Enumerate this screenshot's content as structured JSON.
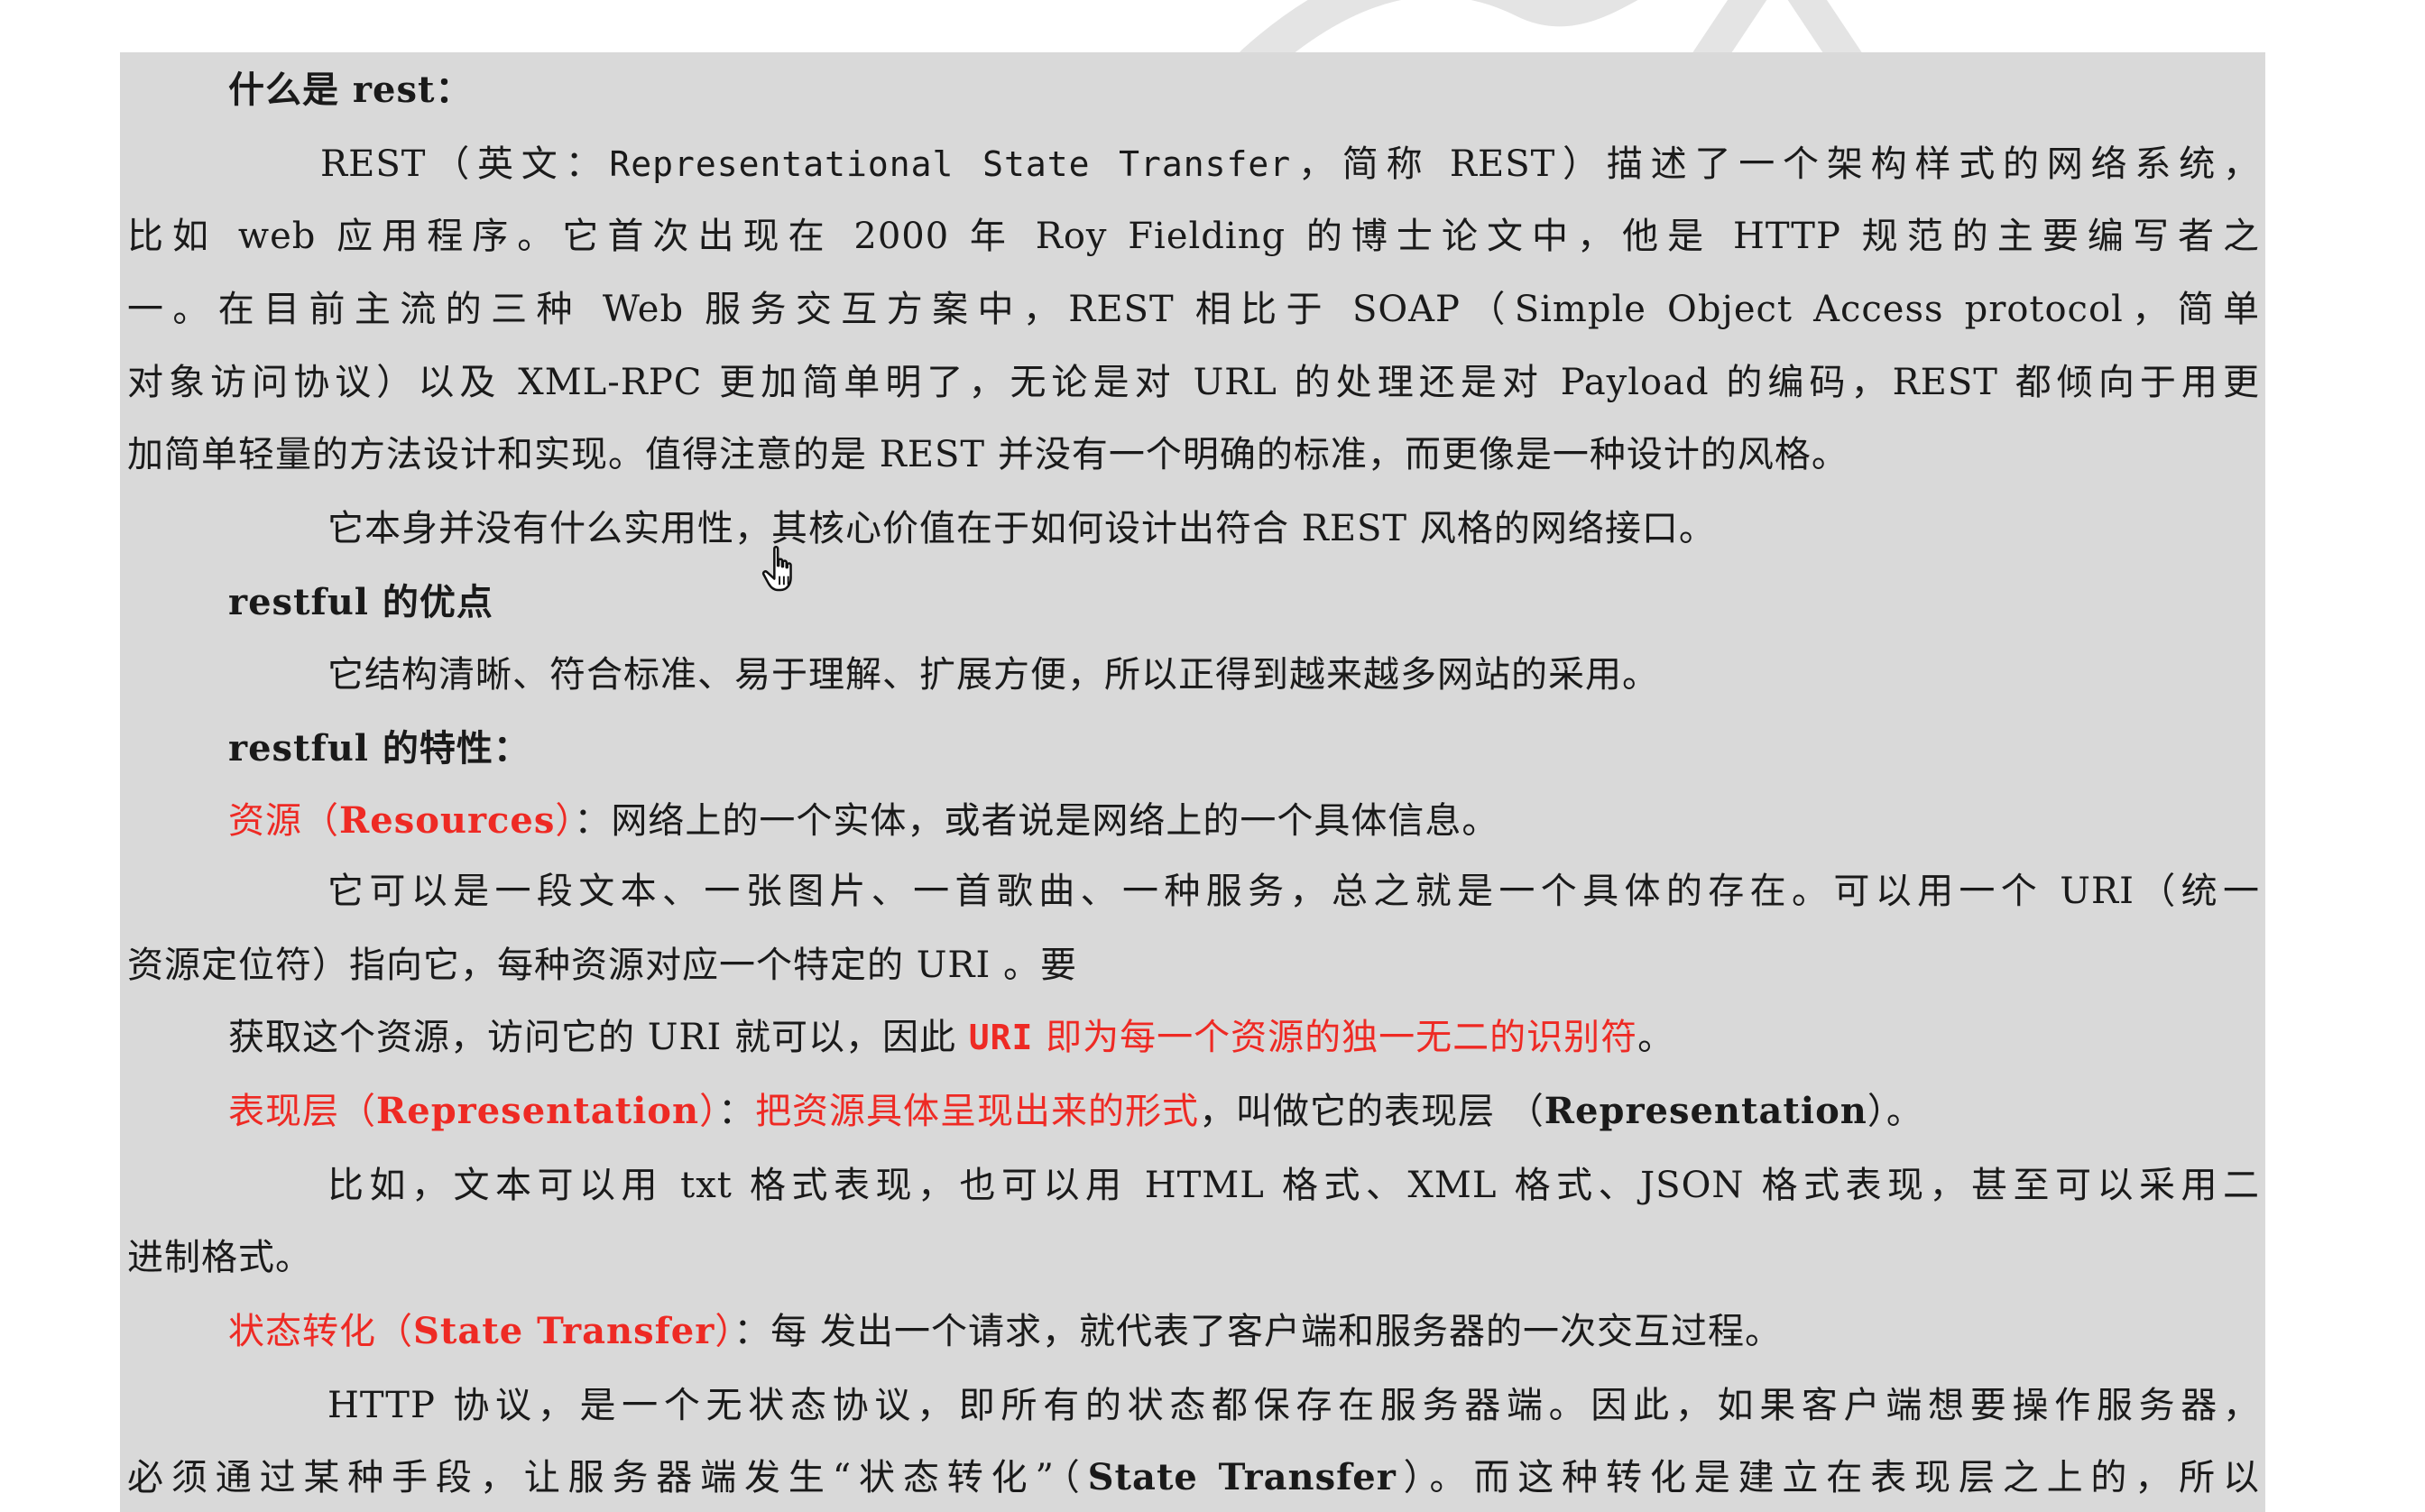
{
  "document": {
    "line01": {
      "text": "什么是 rest："
    },
    "line02": {
      "a": "REST（英文：",
      "b": "Representational State Transfer",
      "c": "，简称 REST）描述了一个架构样式的网络系统，"
    },
    "line03": {
      "a": "比如 web 应用程序。它首次出现在 2000 年 Roy Fielding 的博士论文中，他是 HTTP 规范的主要编写者之"
    },
    "line04": {
      "a": "一。在目前主流的三种 Web 服务交互方案中，REST 相比于 SOAP（Simple Object Access protocol，简单"
    },
    "line05": {
      "a": "对象访问协议）以及 XML-RPC 更加简单明了，无论是对 URL 的处理还是对 Payload 的编码，REST 都倾向于用更"
    },
    "line06": {
      "a": "加简单轻量的方法设计和实现。值得注意的是 REST 并没有一个明确的标准，而更像是一种设计的风格。"
    },
    "line07": {
      "a": "它本身并没有什么实用性，其核心价值在于如何设计出符合 REST 风格的网络接口。"
    },
    "line08": {
      "a": "restful 的优点"
    },
    "line09": {
      "a": "它结构清晰、符合标准、易于理解、扩展方便，所以正得到越来越多网站的采用。"
    },
    "line10": {
      "a": "restful 的特性："
    },
    "line11": {
      "red": "资源（",
      "redbold": "Resources",
      "red2": "）",
      "rest": "：网络上的一个实体，或者说是网络上的一个具体信息。"
    },
    "line12": {
      "a": "它可以是一段文本、一张图片、一首歌曲、一种服务，总之就是一个具体的存在。可以用一个 URI（统一"
    },
    "line13": {
      "a": "资源定位符）指向它，每种资源对应一个特定的 URI 。要"
    },
    "line14": {
      "a": "获取这个资源，访问它的 URI 就可以，因此 ",
      "uri": "URI",
      "red": " 即为每一个资源的独一无二的识别符",
      "end": "。"
    },
    "line15": {
      "red": "表现层（",
      "redbold": "Representation",
      "red2": "）",
      "colon": "：",
      "red3": "把资源具体呈现出来的形式",
      "mid": "，叫做它的表现层 （",
      "bold": "Representation",
      "end": "）。"
    },
    "line16": {
      "a": "比如，文本可以用 txt 格式表现，也可以用 HTML 格式、XML 格式、JSON 格式表现，甚至可以采用二"
    },
    "line17": {
      "a": "进制格式。"
    },
    "line18": {
      "red": "状态转化（",
      "redbold": "State Transfer",
      "red2": "）",
      "rest": "：每 发出一个请求，就代表了客户端和服务器的一次交互过程。"
    },
    "line19": {
      "a": "HTTP 协议，是一个无状态协议，即所有的状态都保存在服务器端。因此，如果客户端想要操作服务器，"
    },
    "line20": {
      "a": "必须通过某种手段，让服务器端发生“状态转化”（",
      "bold": "State Transfer",
      "end": "）。而这种转化是建立在表现层之上的，所以"
    }
  },
  "cursor": {
    "icon": "hand-pointer-icon"
  },
  "watermark": {
    "icon": "watermark-logo-icon"
  },
  "colors": {
    "page": "#d9d9d9",
    "text": "#1a1a1a",
    "accent": "#ee2a24"
  }
}
